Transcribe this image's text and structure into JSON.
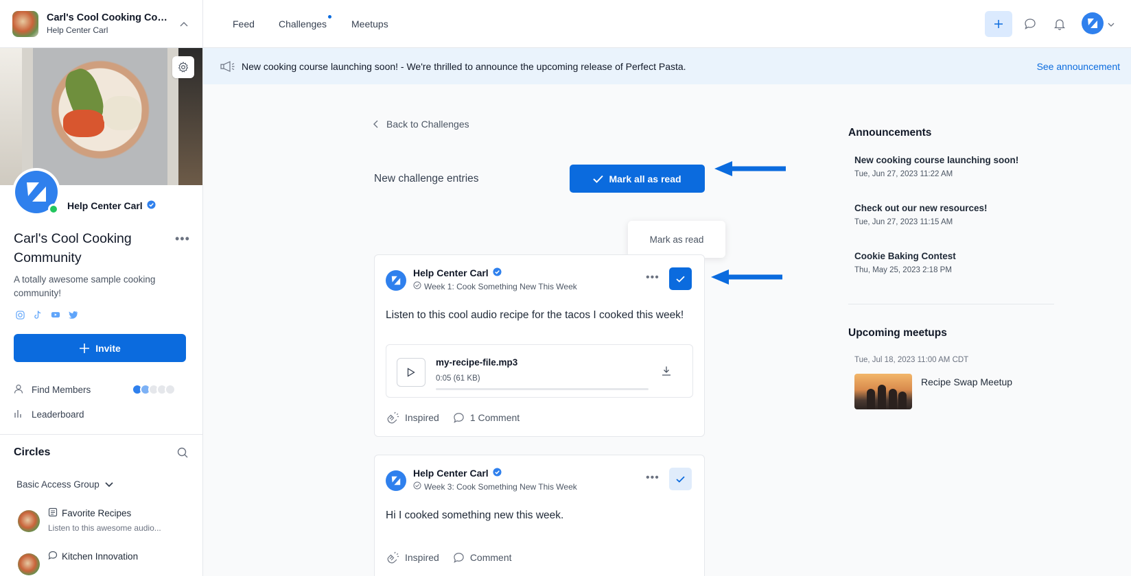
{
  "sidebar": {
    "community_title": "Carl's Cool Cooking Com...",
    "community_subtitle": "Help Center Carl",
    "profile_name": "Help Center Carl",
    "community_name": "Carl's Cool Cooking Community",
    "community_desc": "A totally awesome sample cooking community!",
    "socials": [
      "instagram-icon",
      "tiktok-icon",
      "youtube-icon",
      "twitter-icon"
    ],
    "invite_label": "Invite",
    "nav": [
      {
        "label": "Find Members",
        "icon": "user-icon"
      },
      {
        "label": "Leaderboard",
        "icon": "bar-chart-icon"
      }
    ],
    "circles_title": "Circles",
    "access_group": "Basic Access Group",
    "circles": [
      {
        "name": "Favorite Recipes",
        "sub": "Listen to this awesome audio...",
        "icon": "document-icon"
      },
      {
        "name": "Kitchen Innovation",
        "sub": "",
        "icon": "chat-icon"
      }
    ]
  },
  "topbar": {
    "tabs": [
      "Feed",
      "Challenges",
      "Meetups"
    ]
  },
  "banner": {
    "text": "New cooking course launching soon! - We're thrilled to announce the upcoming release of Perfect Pasta.",
    "link": "See announcement"
  },
  "main": {
    "back_label": "Back to Challenges",
    "section_title": "New challenge entries",
    "mark_all_label": "Mark all as read",
    "tooltip": "Mark as read",
    "entries": [
      {
        "author": "Help Center Carl",
        "week": "Week 1: Cook Something New This Week",
        "body": "Listen to this cool audio recipe for the tacos I cooked this week!",
        "audio_name": "my-recipe-file.mp3",
        "audio_meta": "0:05 (61 KB)",
        "inspired": "Inspired",
        "comments": "1 Comment",
        "read": true
      },
      {
        "author": "Help Center Carl",
        "week": "Week 3: Cook Something New This Week",
        "body": "Hi I cooked something new this week.",
        "inspired": "Inspired",
        "comments": "Comment",
        "read": false
      }
    ]
  },
  "right": {
    "announcements_title": "Announcements",
    "announcements": [
      {
        "title": "New cooking course launching soon!",
        "date": "Tue, Jun 27, 2023 11:22 AM"
      },
      {
        "title": "Check out our new resources!",
        "date": "Tue, Jun 27, 2023 11:15 AM"
      },
      {
        "title": "Cookie Baking Contest",
        "date": "Thu, May 25, 2023 2:18 PM"
      }
    ],
    "meetups_title": "Upcoming meetups",
    "meetup": {
      "date": "Tue, Jul 18, 2023 11:00 AM CDT",
      "title": "Recipe Swap Meetup"
    }
  },
  "colors": {
    "accent": "#0b6bde",
    "banner_bg": "#eaf3fc",
    "online": "#22c55e"
  }
}
